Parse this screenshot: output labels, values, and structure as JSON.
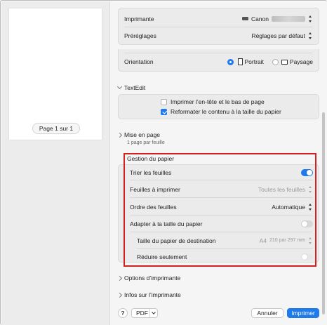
{
  "preview": {
    "page_indicator": "Page 1 sur 1"
  },
  "printer": {
    "label": "Imprimante",
    "value": "Canon"
  },
  "presets": {
    "label": "Préréglages",
    "value": "Réglages par défaut"
  },
  "orientation": {
    "label": "Orientation",
    "options": [
      {
        "label": "Portrait",
        "selected": true
      },
      {
        "label": "Paysage",
        "selected": false
      }
    ]
  },
  "textedit": {
    "title": "TextEdit",
    "options": [
      {
        "label": "Imprimer l’en-tête et le bas de page",
        "checked": false
      },
      {
        "label": "Reformater le contenu à la taille du papier",
        "checked": true
      }
    ]
  },
  "layout": {
    "title": "Mise en page",
    "subtitle": "1 page par feuille"
  },
  "paper_handling": {
    "title": "Gestion du papier",
    "collate": {
      "label": "Trier les feuilles",
      "on": true
    },
    "pages_to_print": {
      "label": "Feuilles à imprimer",
      "value": "Toutes les feuilles"
    },
    "page_order": {
      "label": "Ordre des feuilles",
      "value": "Automatique"
    },
    "scale_to_fit": {
      "label": "Adapter à la taille du papier",
      "on": false
    },
    "destination_size": {
      "label": "Taille du papier de destination",
      "value_main": "A4",
      "value_sub": "210 par 297 mm"
    },
    "scale_down_only": {
      "label": "Réduire seulement",
      "on": false
    }
  },
  "printer_options": {
    "title": "Options d’imprimante"
  },
  "printer_info": {
    "title": "Infos sur l’imprimante"
  },
  "footer": {
    "help": "?",
    "pdf": "PDF",
    "cancel": "Annuler",
    "print": "Imprimer"
  },
  "colors": {
    "accent": "#1f7aec",
    "highlight": "#d6201f"
  }
}
